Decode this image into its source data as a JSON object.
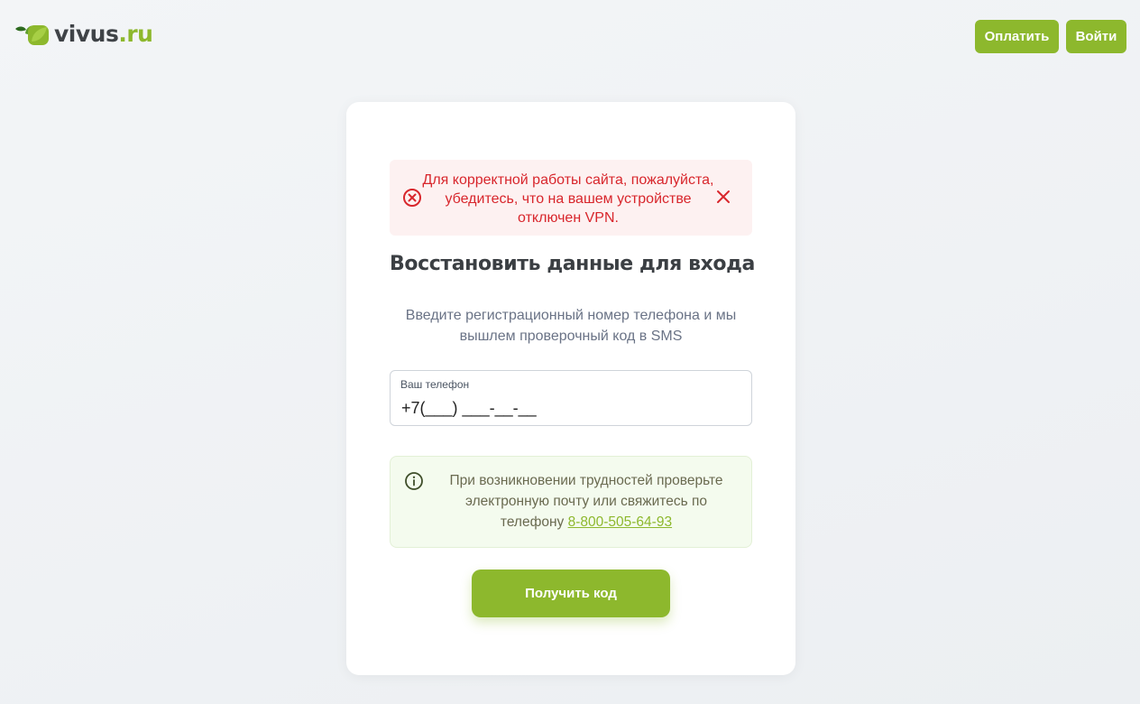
{
  "header": {
    "logo_brand": "vivus",
    "logo_tld": ".ru",
    "pay_button": "Оплатить",
    "login_button": "Войти"
  },
  "alert": {
    "message": "Для корректной работы сайта, пожалуйста, убедитесь, что на вашем устройстве отключен VPN."
  },
  "form": {
    "title": "Восстановить данные для входа",
    "subtitle": "Введите регистрационный номер телефона и мы вышлем проверочный код в SMS",
    "phone_label": "Ваш телефон",
    "phone_placeholder": "+7(___) ___-__-__",
    "phone_value": ""
  },
  "info": {
    "text": "При возникновении трудностей проверьте электронную почту или свяжитесь по телефону ",
    "phone_link": "8-800-505-64-93"
  },
  "submit_button": "Получить код",
  "colors": {
    "accent": "#8db82d",
    "alert_text": "#d8262c",
    "alert_bg": "#fdf1f1",
    "info_bg": "#f4fbee",
    "title": "#3b3f43"
  }
}
